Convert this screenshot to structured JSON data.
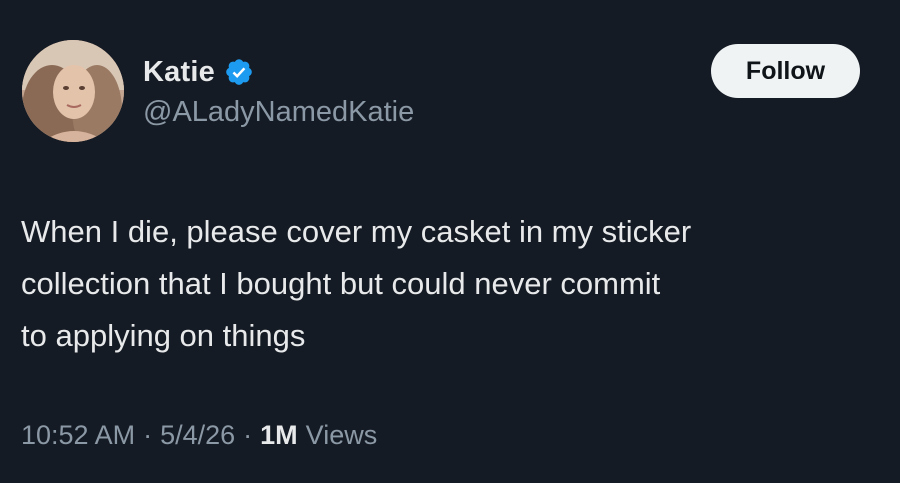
{
  "tweet": {
    "author": {
      "display_name": "Katie",
      "handle": "@ALadyNamedKatie",
      "verified": true,
      "avatar_icon": "profile-photo"
    },
    "follow_label": "Follow",
    "text_lines": [
      "When I die, please cover my casket in my sticker",
      "collection that I bought but could never commit",
      "to applying on things"
    ],
    "time": "10:52 AM",
    "separator": "·",
    "date": "5/4/26",
    "views_count": "1M",
    "views_label": "Views"
  },
  "colors": {
    "background": "#151b24",
    "primary_text": "#e7e9ea",
    "secondary_text": "#8b98a5",
    "verified_blue": "#1d9bf0",
    "follow_bg": "#eff3f4"
  }
}
